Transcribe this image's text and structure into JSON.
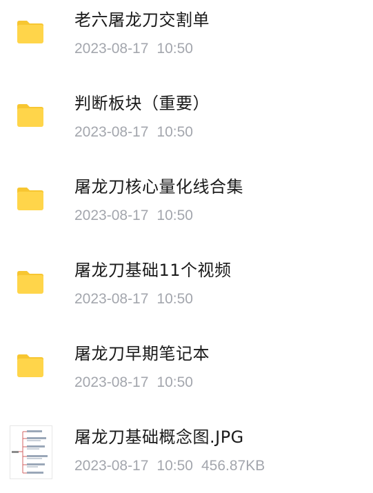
{
  "colors": {
    "folder": "#ffd54a",
    "folder_tab": "#f7c631",
    "name_text": "#1a1a1a",
    "meta_text": "#a3a6ad",
    "background": "#ffffff"
  },
  "files": [
    {
      "type": "folder",
      "icon": "folder-icon",
      "name": "老六屠龙刀交割单",
      "date": "2023-08-17",
      "time": "10:50",
      "size": ""
    },
    {
      "type": "folder",
      "icon": "folder-icon",
      "name": "判断板块（重要）",
      "date": "2023-08-17",
      "time": "10:50",
      "size": ""
    },
    {
      "type": "folder",
      "icon": "folder-icon",
      "name": "屠龙刀核心量化线合集",
      "date": "2023-08-17",
      "time": "10:50",
      "size": ""
    },
    {
      "type": "folder",
      "icon": "folder-icon",
      "name": "屠龙刀基础11个视频",
      "date": "2023-08-17",
      "time": "10:50",
      "size": ""
    },
    {
      "type": "folder",
      "icon": "folder-icon",
      "name": "屠龙刀早期笔记本",
      "date": "2023-08-17",
      "time": "10:50",
      "size": ""
    },
    {
      "type": "image",
      "icon": "image-thumbnail",
      "name": "屠龙刀基础概念图.JPG",
      "date": "2023-08-17",
      "time": "10:50",
      "size": "456.87KB"
    }
  ]
}
